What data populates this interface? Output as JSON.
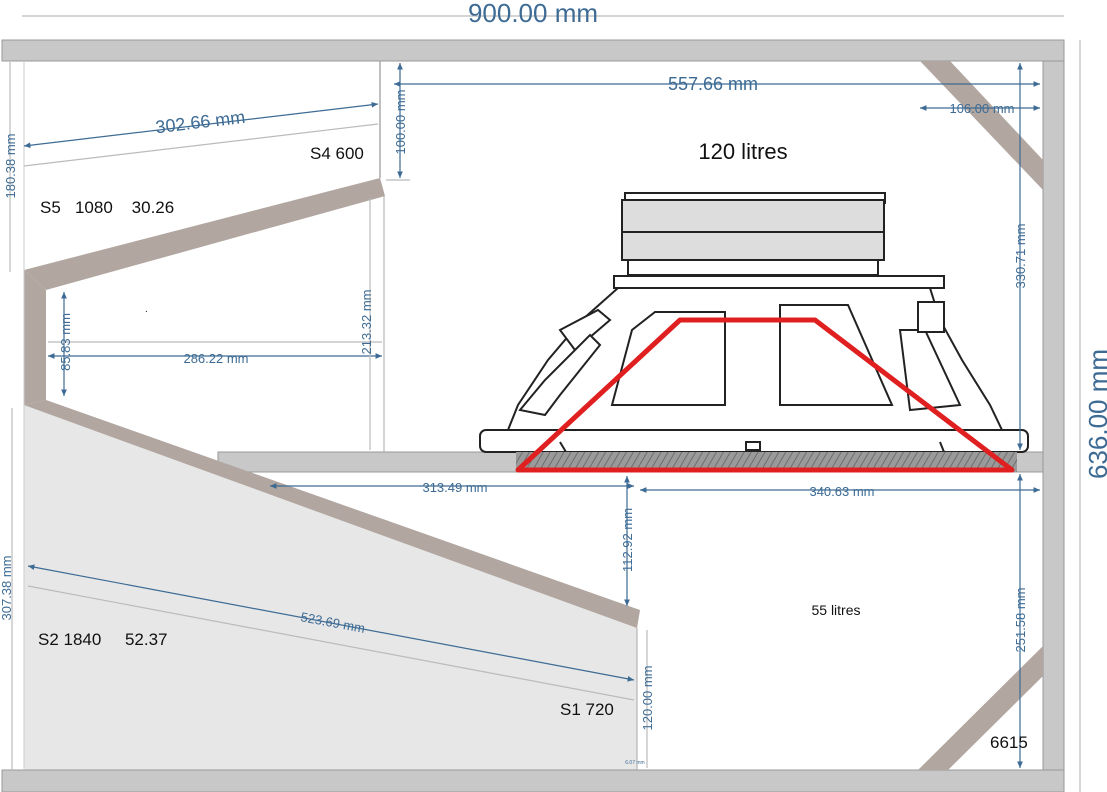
{
  "dimensions": {
    "total_width": "900.00 mm",
    "total_height": "636.00 mm",
    "d_557": "557.66 mm",
    "d_106": "106.00 mm",
    "d_302": "302.66 mm",
    "d_100": "100.00 mm",
    "d_180": "180.38 mm",
    "d_330": "330.71 mm",
    "d_85": "85.83 mm",
    "d_286": "286.22 mm",
    "d_213": "213.32 mm",
    "d_313": "313.49 mm",
    "d_340": "340.63 mm",
    "d_112": "112.92 mm",
    "d_307": "307.38 mm",
    "d_523": "523.69 mm",
    "d_251": "251.58 mm",
    "d_120": "120.00 mm",
    "d_tiny": "6.07 mm"
  },
  "labels": {
    "volume_upper": "120 litres",
    "volume_lower": "55 litres",
    "s4": "S4 600",
    "s5": "S5   1080    30.26",
    "s2": "S2 1840     52.37",
    "s1": "S1 720",
    "corner": "6615",
    "dot": "."
  },
  "colors": {
    "panel": "#c8c8c8",
    "brace": "#b1a6a0",
    "dimension": "#3d6b94",
    "lower_horn_fill": "#e6e6e6",
    "driver_outline": "#222222",
    "highlight": "#e02020"
  }
}
